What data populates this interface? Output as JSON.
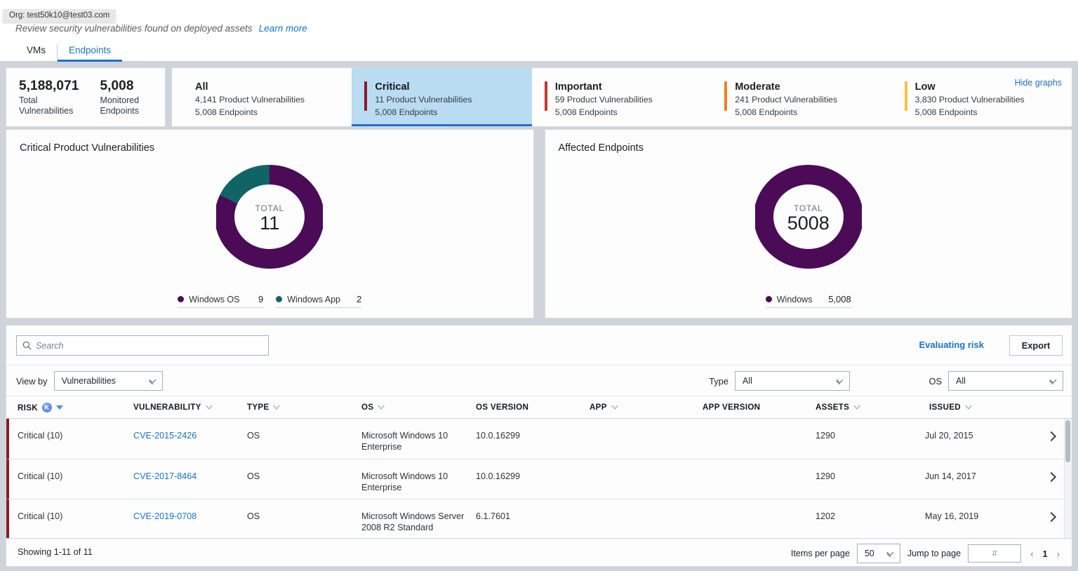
{
  "header": {
    "org_tooltip": "Org: test50k10@test03.com",
    "subtitle": "Review security vulnerabilities found on deployed assets",
    "learn_more": "Learn more",
    "tabs": [
      {
        "label": "VMs",
        "active": false
      },
      {
        "label": "Endpoints",
        "active": true
      }
    ]
  },
  "summary": {
    "totals": [
      {
        "value": "5,188,071",
        "line1": "Total",
        "line2": "Vulnerabilities"
      },
      {
        "value": "5,008",
        "line1": "Monitored",
        "line2": "Endpoints"
      }
    ],
    "hide_graphs": "Hide graphs",
    "severities": [
      {
        "label": "All",
        "vulns": "4,141 Product Vulnerabilities",
        "endpoints": "5,008 Endpoints",
        "color": "",
        "selected": false
      },
      {
        "label": "Critical",
        "vulns": "11 Product Vulnerabilities",
        "endpoints": "5,008 Endpoints",
        "color": "#8b1a25",
        "selected": true
      },
      {
        "label": "Important",
        "vulns": "59 Product Vulnerabilities",
        "endpoints": "5,008 Endpoints",
        "color": "#c0392b",
        "selected": false
      },
      {
        "label": "Moderate",
        "vulns": "241 Product Vulnerabilities",
        "endpoints": "5,008 Endpoints",
        "color": "#f08020",
        "selected": false
      },
      {
        "label": "Low",
        "vulns": "3,830 Product Vulnerabilities",
        "endpoints": "5,008 Endpoints",
        "color": "#f5c23e",
        "selected": false
      }
    ]
  },
  "chart_data": [
    {
      "type": "pie",
      "title": "Critical Product Vulnerabilities",
      "center_label": "TOTAL",
      "center_value": "11",
      "total": 11,
      "categories": [
        "Windows OS",
        "Windows App"
      ],
      "values": [
        9,
        2
      ],
      "value_labels": [
        "9",
        "2"
      ],
      "colors": [
        "#4b0b57",
        "#116466"
      ],
      "legend_position": "bottom"
    },
    {
      "type": "pie",
      "title": "Affected Endpoints",
      "center_label": "TOTAL",
      "center_value": "5008",
      "total": 5008,
      "categories": [
        "Windows"
      ],
      "values": [
        5008
      ],
      "value_labels": [
        "5,008"
      ],
      "colors": [
        "#4b0b57"
      ],
      "legend_position": "bottom"
    }
  ],
  "toolbar": {
    "search_placeholder": "Search",
    "search_value": "",
    "evaluating_risk": "Evaluating risk",
    "export_label": "Export"
  },
  "filters": {
    "view_by_label": "View by",
    "view_by_value": "Vulnerabilities",
    "type_label": "Type",
    "type_value": "All",
    "os_label": "OS",
    "os_value": "All"
  },
  "table": {
    "columns": [
      {
        "label": "RISK",
        "sort": "solid",
        "badge": "K"
      },
      {
        "label": "VULNERABILITY",
        "sort": "hollow"
      },
      {
        "label": "TYPE",
        "sort": "hollow"
      },
      {
        "label": "OS",
        "sort": "hollow"
      },
      {
        "label": "OS VERSION",
        "sort": "none"
      },
      {
        "label": "APP",
        "sort": "hollow"
      },
      {
        "label": "APP VERSION",
        "sort": "none"
      },
      {
        "label": "ASSETS",
        "sort": "hollow"
      },
      {
        "label": "ISSUED",
        "sort": "hollow"
      }
    ],
    "rows": [
      {
        "risk": "Critical (10)",
        "vulnerability": "CVE-2015-2426",
        "type": "OS",
        "os": "Microsoft Windows 10 Enterprise",
        "os_version": "10.0.16299",
        "app": "",
        "app_version": "",
        "assets": "1290",
        "issued": "Jul 20, 2015"
      },
      {
        "risk": "Critical (10)",
        "vulnerability": "CVE-2017-8464",
        "type": "OS",
        "os": "Microsoft Windows 10 Enterprise",
        "os_version": "10.0.16299",
        "app": "",
        "app_version": "",
        "assets": "1290",
        "issued": "Jun 14, 2017"
      },
      {
        "risk": "Critical (10)",
        "vulnerability": "CVE-2019-0708",
        "type": "OS",
        "os": "Microsoft Windows Server 2008 R2 Standard",
        "os_version": "6.1.7601",
        "app": "",
        "app_version": "",
        "assets": "1202",
        "issued": "May 16, 2019"
      }
    ]
  },
  "footer": {
    "showing": "Showing 1-11 of 11",
    "items_per_page_label": "Items per page",
    "items_per_page_value": "50",
    "jump_label": "Jump to page",
    "jump_placeholder": "#",
    "prev": "‹",
    "page": "1",
    "next": "›"
  }
}
